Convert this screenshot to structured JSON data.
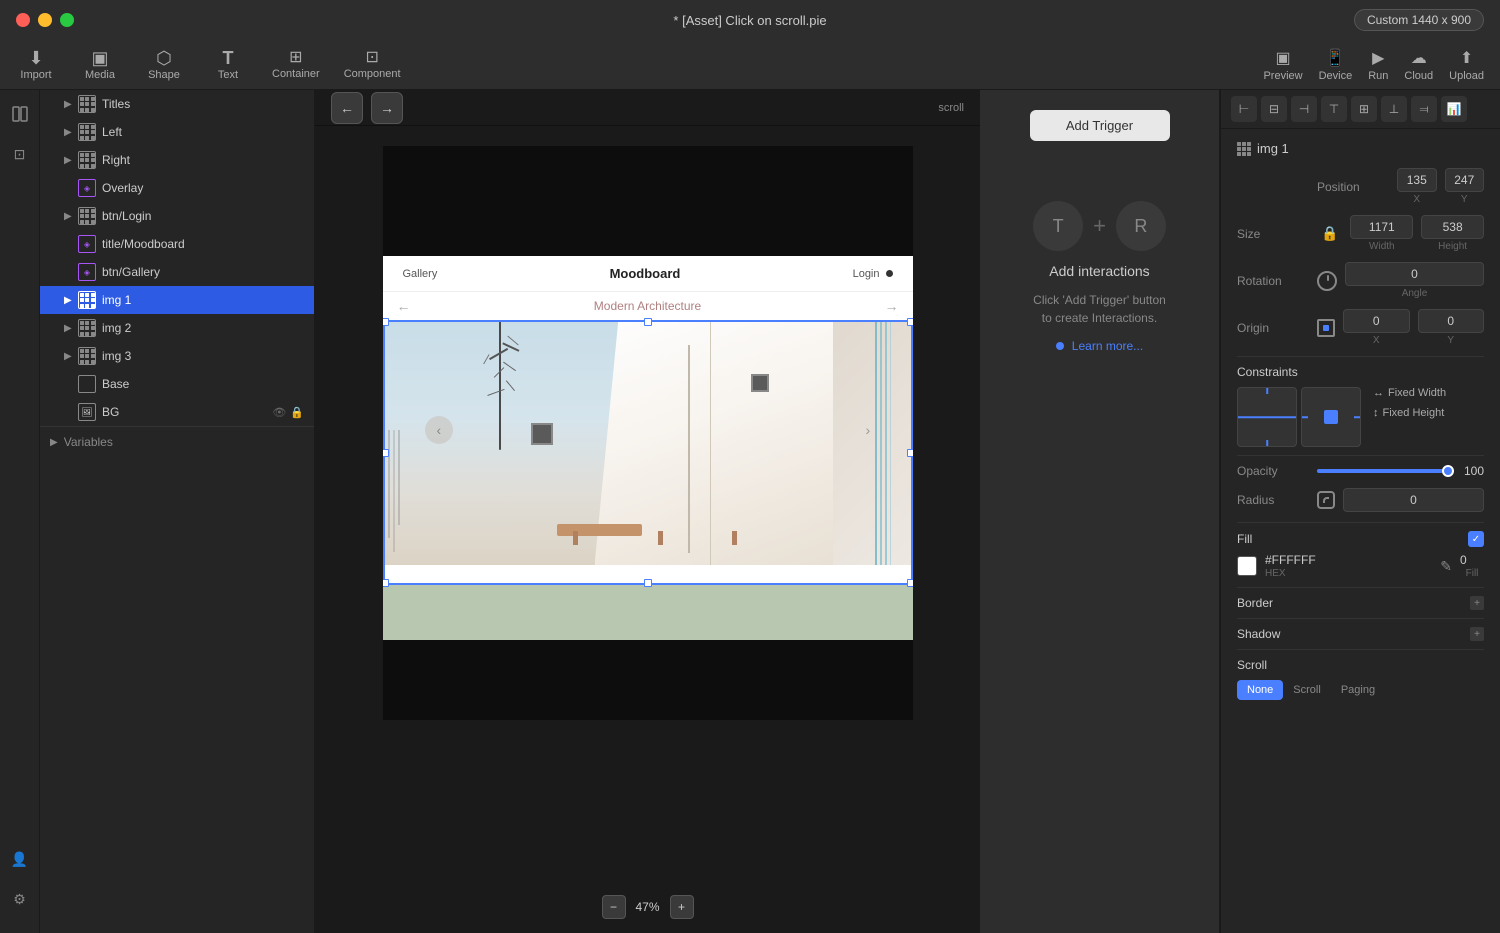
{
  "titlebar": {
    "title": "* [Asset] Click on scroll.pie",
    "device_label": "Custom  1440 x 900"
  },
  "toolbar": {
    "left_items": [
      {
        "label": "Import",
        "icon": "⬇"
      },
      {
        "label": "Media",
        "icon": "▣"
      },
      {
        "label": "Shape",
        "icon": "⬡"
      },
      {
        "label": "Text",
        "icon": "T"
      },
      {
        "label": "Container",
        "icon": "⊞"
      },
      {
        "label": "Component",
        "icon": "⊡"
      }
    ],
    "right_items": [
      {
        "label": "Preview",
        "icon": "▣"
      },
      {
        "label": "Device",
        "icon": "📱"
      },
      {
        "label": "Run",
        "icon": "▶"
      },
      {
        "label": "Cloud",
        "icon": "☁"
      },
      {
        "label": "Upload",
        "icon": "⬆"
      }
    ]
  },
  "layers": {
    "items": [
      {
        "id": "titles",
        "label": "Titles",
        "type": "frame",
        "indent": 1,
        "expandable": true
      },
      {
        "id": "left",
        "label": "Left",
        "type": "frame",
        "indent": 1,
        "expandable": true
      },
      {
        "id": "right",
        "label": "Right",
        "type": "frame",
        "indent": 1,
        "expandable": true
      },
      {
        "id": "overlay",
        "label": "Overlay",
        "type": "component",
        "indent": 1,
        "expandable": false
      },
      {
        "id": "btn-login",
        "label": "btn/Login",
        "type": "frame",
        "indent": 1,
        "expandable": true
      },
      {
        "id": "title-moodboard",
        "label": "title/Moodboard",
        "type": "component",
        "indent": 1,
        "expandable": false
      },
      {
        "id": "btn-gallery",
        "label": "btn/Gallery",
        "type": "component",
        "indent": 1,
        "expandable": false
      },
      {
        "id": "img1",
        "label": "img 1",
        "type": "frame",
        "indent": 1,
        "expandable": true,
        "selected": true
      },
      {
        "id": "img2",
        "label": "img 2",
        "type": "frame",
        "indent": 1,
        "expandable": true
      },
      {
        "id": "img3",
        "label": "img 3",
        "type": "frame",
        "indent": 1,
        "expandable": true
      },
      {
        "id": "base",
        "label": "Base",
        "type": "rect",
        "indent": 1,
        "expandable": false
      },
      {
        "id": "bg",
        "label": "BG",
        "type": "image",
        "indent": 1,
        "expandable": false,
        "locked": true,
        "hidden": true
      }
    ],
    "variables_label": "Variables"
  },
  "canvas": {
    "nav_back": "←",
    "nav_forward": "→",
    "zoom_percent": "47%",
    "frame_title": "scroll",
    "design": {
      "nav": {
        "gallery": "Gallery",
        "moodboard": "Moodboard",
        "login": "Login"
      },
      "subtitle": "Modern Architecture",
      "image_alt": "Modern architecture building with stairs"
    }
  },
  "interactions": {
    "add_trigger_label": "Add Trigger",
    "t_label": "T",
    "r_label": "R",
    "title": "Add interactions",
    "description": "Click 'Add Trigger' button\nto create Interactions.",
    "learn_label": "Learn more..."
  },
  "properties": {
    "panel_title": "img 1",
    "position": {
      "x_value": "135",
      "x_label": "X",
      "y_value": "247",
      "y_label": "Y"
    },
    "size": {
      "width_value": "1171",
      "width_label": "Width",
      "height_value": "538",
      "height_label": "Height"
    },
    "rotation": {
      "value": "0",
      "label": "Angle"
    },
    "origin": {
      "x_value": "0",
      "y_value": "0",
      "x_label": "X",
      "y_label": "Y"
    },
    "constraints_title": "Constraints",
    "fixed_width_label": "Fixed Width",
    "fixed_height_label": "Fixed Height",
    "opacity": {
      "label": "Opacity",
      "value": "100"
    },
    "radius": {
      "label": "Radius",
      "value": "0"
    },
    "fill": {
      "label": "Fill",
      "hex": "#FFFFFF",
      "hex_label": "HEX",
      "opacity_value": "0",
      "opacity_label": "Fill"
    },
    "border_label": "Border",
    "shadow_label": "Shadow",
    "scroll": {
      "label": "Scroll",
      "tabs": [
        "None",
        "Scroll",
        "Paging"
      ]
    }
  },
  "colors": {
    "accent": "#4a7fff",
    "selected_bg": "#2d5be3",
    "panel_bg": "#252525",
    "toolbar_bg": "#2d2d2d",
    "canvas_bg": "#1a1a1a",
    "input_bg": "#333333"
  }
}
